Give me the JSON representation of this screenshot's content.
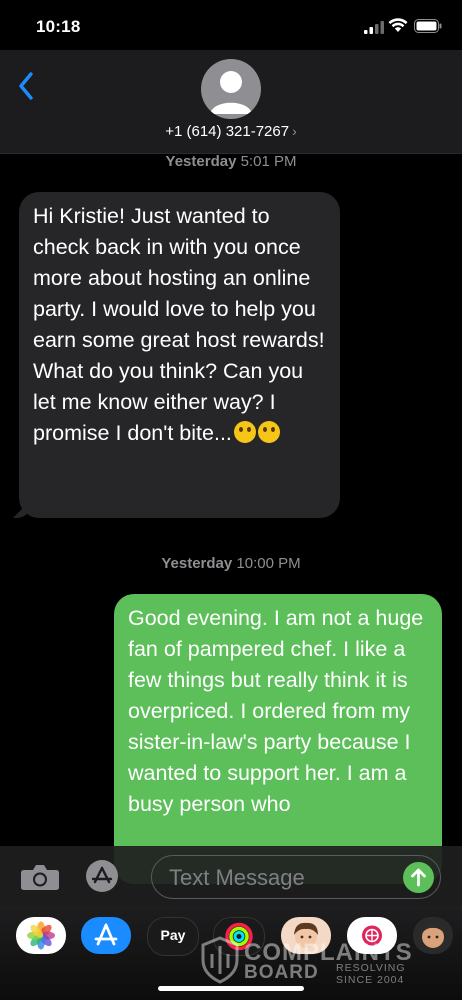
{
  "status_bar": {
    "time": "10:18",
    "signal_icon": "cellular-signal-icon",
    "wifi_icon": "wifi-icon",
    "battery_icon": "battery-icon"
  },
  "header": {
    "back_icon": "chevron-left-icon",
    "avatar_icon": "person-icon",
    "contact": "+1 (614) 321-7267",
    "contact_chevron": "›"
  },
  "messages": [
    {
      "timestamp_day": "Yesterday",
      "timestamp_time": "5:01 PM",
      "direction": "incoming",
      "text": "Hi Kristie! Just wanted to check back in with you once more about hosting an online party. I would love to help you earn some great host rewards! What do you think? Can you let me know either way? I promise I don't bite...",
      "emojis": [
        "smiling-face-emoji",
        "tears-of-joy-emoji"
      ]
    },
    {
      "timestamp_day": "Yesterday",
      "timestamp_time": "10:00 PM",
      "direction": "outgoing",
      "text": "Good evening. I am not a huge fan of pampered chef. I like a few things but really think it is overpriced. I ordered from my sister-in-law's party because I wanted to support her. I am a busy person who"
    }
  ],
  "input": {
    "camera_icon": "camera-icon",
    "apps_icon": "app-store-icon",
    "placeholder": "Text Message",
    "send_icon": "arrow-up-icon"
  },
  "app_drawer": [
    {
      "name": "photos-icon"
    },
    {
      "name": "app-store-icon"
    },
    {
      "name": "apple-pay-icon",
      "label": "Pay"
    },
    {
      "name": "fitness-rings-icon"
    },
    {
      "name": "memoji-icon"
    },
    {
      "name": "web-search-icon"
    },
    {
      "name": "memoji-stickers-icon"
    }
  ],
  "watermark": {
    "line1": "COMPLAINTS",
    "line2": "BOARD",
    "sub1": "RESOLVING",
    "sub2": "SINCE 2004"
  },
  "colors": {
    "incoming_bubble": "#262628",
    "outgoing_bubble": "#5cbf5a",
    "accent_blue": "#1a8cff",
    "background": "#000000"
  }
}
